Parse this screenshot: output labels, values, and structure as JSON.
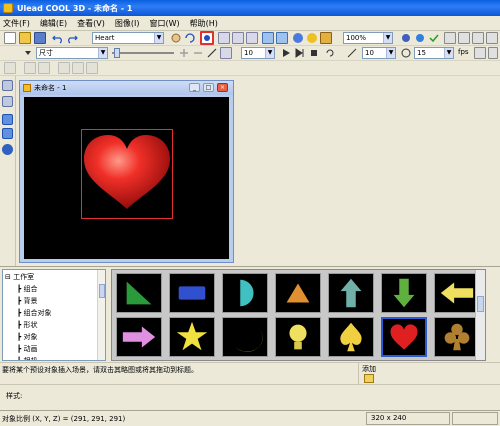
{
  "app": {
    "title": "Ulead COOL 3D - 未命名 - 1"
  },
  "menu": [
    "文件(F)",
    "编辑(E)",
    "查看(V)",
    "图像(I)",
    "窗口(W)",
    "帮助(H)"
  ],
  "toolbar": {
    "object_select": "Heart",
    "zoom": "100%",
    "size_select": "尺寸",
    "field_a": "10",
    "field_b": "10",
    "field_c": "15",
    "fps_label": "fps"
  },
  "document": {
    "title": "未命名 - 1"
  },
  "tree": {
    "items": [
      "工作室",
      "组合",
      "背景",
      "组合对象",
      "形状",
      "对象",
      "动画",
      "相机"
    ]
  },
  "gallery": {
    "items": [
      "green-triangle",
      "blue-rectangle",
      "cyan-half-circle",
      "orange-triangle",
      "teal-up-arrow",
      "green-down-arrow",
      "yellow-left-arrow",
      "pink-right-arrow",
      "yellow-star",
      "yellow-crescent",
      "yellow-bulb",
      "yellow-spade",
      "red-heart",
      "brown-club"
    ],
    "selected_index": 12
  },
  "hint": {
    "text": "要将某个预设对象插入场景，请双击其略图或将其拖动到标题。"
  },
  "add": {
    "label": "添加"
  },
  "properties": {
    "label": "样式:"
  },
  "status": {
    "scale": "对象比例 (X, Y, Z) = (291, 291, 291)",
    "size": "320 x 240"
  },
  "colors": {
    "title_blue": "#0b5ad8",
    "heart_red": "#e02020",
    "select_red": "#e03030"
  }
}
